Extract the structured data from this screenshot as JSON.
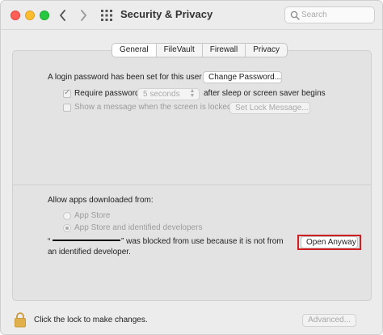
{
  "window": {
    "title": "Security & Privacy",
    "search": {
      "placeholder": "Search",
      "value": ""
    }
  },
  "tabs": [
    {
      "label": "General",
      "active": true
    },
    {
      "label": "FileVault",
      "active": false
    },
    {
      "label": "Firewall",
      "active": false
    },
    {
      "label": "Privacy",
      "active": false
    }
  ],
  "general": {
    "login_text": "A login password has been set for this user",
    "change_password_label": "Change Password...",
    "require_password": {
      "label": "Require password",
      "checked": true,
      "enabled": false
    },
    "delay_select": {
      "value": "5 seconds",
      "enabled": false
    },
    "after_sleep_text": "after sleep or screen saver begins",
    "show_message": {
      "label": "Show a message when the screen is locked",
      "checked": false,
      "enabled": false
    },
    "set_lock_message_label": "Set Lock Message..."
  },
  "apps": {
    "heading": "Allow apps downloaded from:",
    "options": [
      {
        "label": "App Store",
        "selected": false
      },
      {
        "label": "App Store and identified developers",
        "selected": true
      }
    ],
    "blocked_quote_open": "“",
    "blocked_line1": "” was blocked from use because it is not from",
    "blocked_line2": "an identified developer.",
    "open_anyway_label": "Open Anyway"
  },
  "footer": {
    "lock_text": "Click the lock to make changes.",
    "advanced_label": "Advanced..."
  },
  "colors": {
    "highlight": "#d01f23",
    "lock": "#d9a441"
  },
  "icons": {
    "lock": "lock-icon",
    "search": "search-icon",
    "grid": "grid-icon"
  }
}
